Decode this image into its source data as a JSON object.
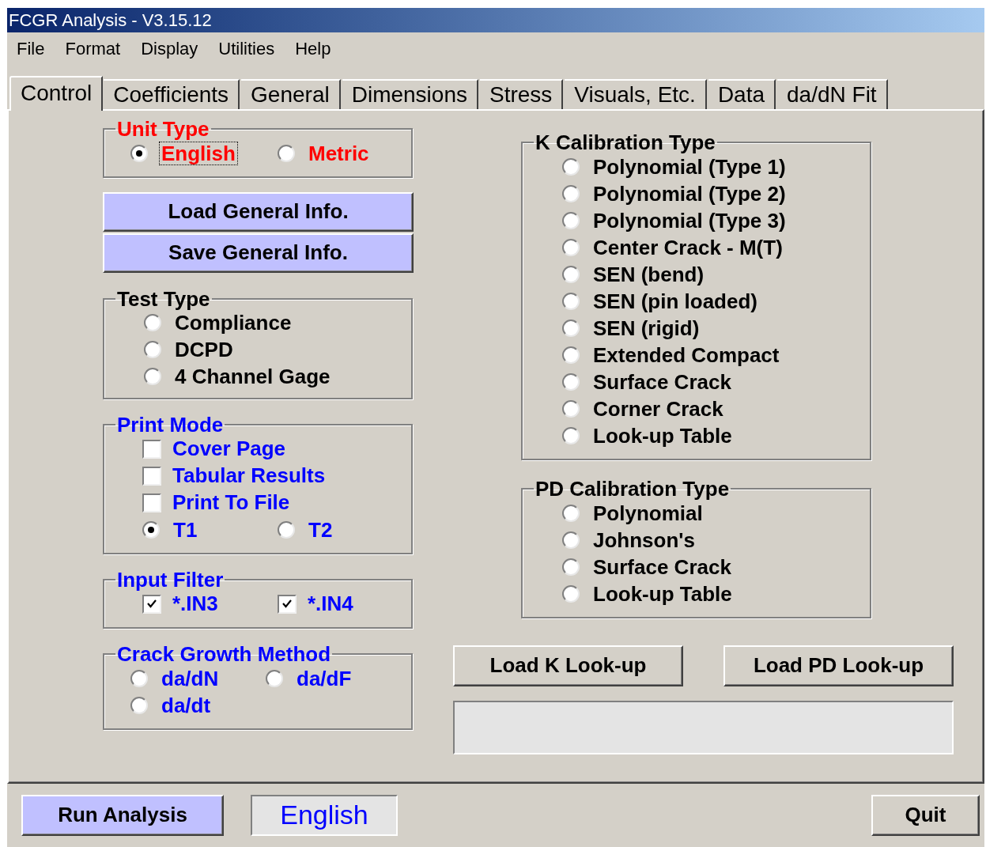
{
  "window": {
    "title": "FCGR Analysis - V3.15.12"
  },
  "menu": [
    "File",
    "Format",
    "Display",
    "Utilities",
    "Help"
  ],
  "tabs": [
    {
      "label": "Control",
      "selected": true
    },
    {
      "label": "Coefficients",
      "selected": false
    },
    {
      "label": "General",
      "selected": false
    },
    {
      "label": "Dimensions",
      "selected": false
    },
    {
      "label": "Stress",
      "selected": false
    },
    {
      "label": "Visuals, Etc.",
      "selected": false
    },
    {
      "label": "Data",
      "selected": false
    },
    {
      "label": "da/dN Fit",
      "selected": false
    }
  ],
  "unit_type": {
    "title": "Unit Type",
    "options": [
      {
        "label": "English",
        "selected": true,
        "focused": true
      },
      {
        "label": "Metric",
        "selected": false,
        "focused": false
      }
    ]
  },
  "general_info_buttons": [
    "Load General Info.",
    "Save General Info."
  ],
  "test_type": {
    "title": "Test Type",
    "options": [
      {
        "label": "Compliance",
        "selected": false
      },
      {
        "label": "DCPD",
        "selected": false
      },
      {
        "label": "4 Channel Gage",
        "selected": false
      }
    ]
  },
  "print_mode": {
    "title": "Print Mode",
    "checkboxes": [
      {
        "label": "Cover Page",
        "checked": false
      },
      {
        "label": "Tabular Results",
        "checked": false
      },
      {
        "label": "Print To File",
        "checked": false
      }
    ],
    "options": [
      {
        "label": "T1",
        "selected": true
      },
      {
        "label": "T2",
        "selected": false
      }
    ]
  },
  "input_filter": {
    "title": "Input Filter",
    "checkboxes": [
      {
        "label": "*.IN3",
        "checked": true
      },
      {
        "label": "*.IN4",
        "checked": true
      }
    ]
  },
  "crack_growth_method": {
    "title": "Crack Growth Method",
    "options": [
      {
        "label": "da/dN",
        "selected": false
      },
      {
        "label": "da/dF",
        "selected": false
      },
      {
        "label": "da/dt",
        "selected": false
      }
    ]
  },
  "k_calibration_type": {
    "title": "K Calibration Type",
    "options": [
      {
        "label": "Polynomial (Type 1)",
        "selected": false
      },
      {
        "label": "Polynomial (Type 2)",
        "selected": false
      },
      {
        "label": "Polynomial (Type 3)",
        "selected": false
      },
      {
        "label": "Center Crack - M(T)",
        "selected": false
      },
      {
        "label": "SEN (bend)",
        "selected": false
      },
      {
        "label": "SEN (pin loaded)",
        "selected": false
      },
      {
        "label": "SEN (rigid)",
        "selected": false
      },
      {
        "label": "Extended Compact",
        "selected": false
      },
      {
        "label": "Surface Crack",
        "selected": false
      },
      {
        "label": "Corner Crack",
        "selected": false
      },
      {
        "label": "Look-up Table",
        "selected": false
      }
    ]
  },
  "pd_calibration_type": {
    "title": "PD Calibration Type",
    "options": [
      {
        "label": "Polynomial",
        "selected": false
      },
      {
        "label": "Johnson's",
        "selected": false
      },
      {
        "label": "Surface Crack",
        "selected": false
      },
      {
        "label": "Look-up Table",
        "selected": false
      }
    ]
  },
  "lookup_buttons": [
    "Load K Look-up",
    "Load PD Look-up"
  ],
  "bottom": {
    "run_button": "Run Analysis",
    "units_display": "English",
    "quit_button": "Quit"
  }
}
